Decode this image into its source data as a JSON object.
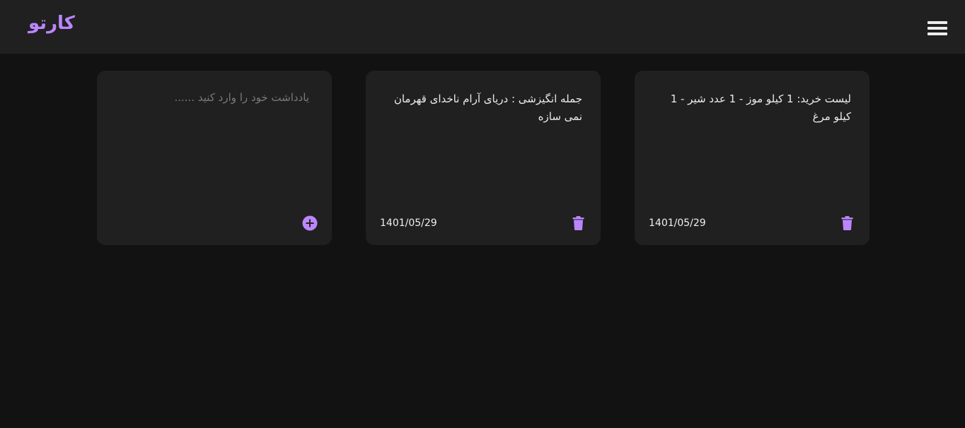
{
  "app": {
    "logo": "کارتو",
    "accent_color": "#bb86fc",
    "menu_icon": "hamburger-menu-icon"
  },
  "new_note": {
    "placeholder": "یادداشت خود را وارد کنید ......",
    "value": "",
    "add_icon": "plus-circle-icon"
  },
  "notes": [
    {
      "text": "جمله انگیزشی : دریای آرام ناخدای قهرمان نمی سازه",
      "date": "1401/05/29",
      "delete_icon": "trash-icon"
    },
    {
      "text": "لیست خرید: 1 کیلو موز - 1 عدد شیر - 1 کیلو مرغ",
      "date": "1401/05/29",
      "delete_icon": "trash-icon"
    }
  ]
}
